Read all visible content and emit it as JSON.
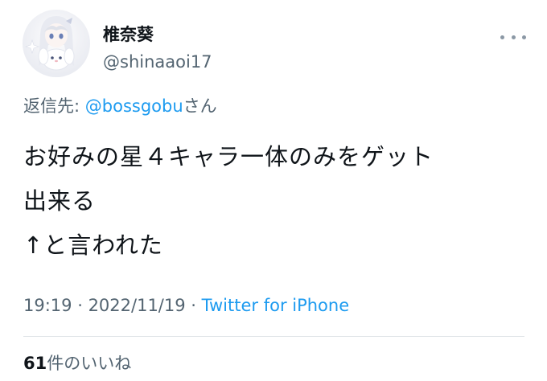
{
  "user": {
    "display_name": "椎奈葵",
    "handle": "@shinaaoi17",
    "avatar": "anime-girl-holding-plush-avatar"
  },
  "menu": {
    "icon": "more-horizontal-icon"
  },
  "reply": {
    "prefix": "返信先: ",
    "mention": "@bossgobu",
    "suffix": "さん"
  },
  "tweet": {
    "text": "お好みの星４キャラ一体のみをゲット\n出来る\n↑と言われた"
  },
  "meta": {
    "time": "19:19",
    "separator1": " · ",
    "date": "2022/11/19",
    "separator2": " · ",
    "source": "Twitter for iPhone"
  },
  "stats": {
    "likes_count": "61",
    "likes_label": "件のいいね"
  },
  "colors": {
    "link": "#1d9bf0",
    "secondary_text": "#536471",
    "primary_text": "#0f1419"
  }
}
